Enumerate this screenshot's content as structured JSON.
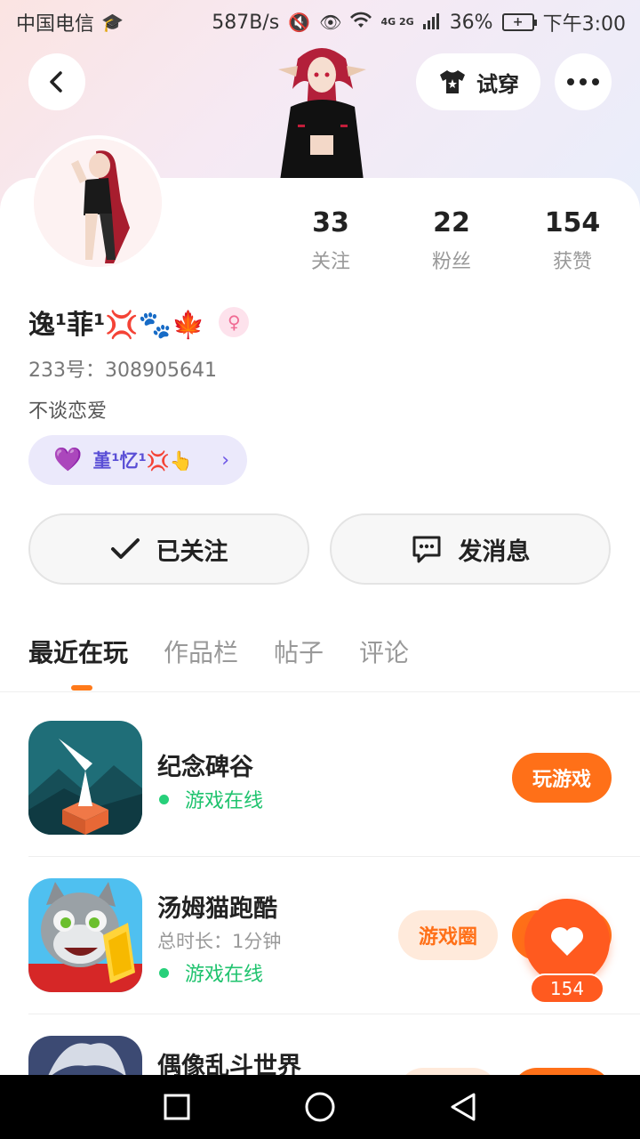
{
  "status_bar": {
    "carrier": "中国电信",
    "net_speed": "587B/s",
    "signal_label": "4G 2G",
    "battery_level": 36,
    "battery": "36%",
    "time": "下午3:00"
  },
  "header": {
    "tryon_label": "试穿"
  },
  "profile": {
    "stats": [
      {
        "value": "33",
        "label": "关注"
      },
      {
        "value": "22",
        "label": "粉丝"
      },
      {
        "value": "154",
        "label": "获赞"
      }
    ],
    "nickname": "逸¹菲¹💢🐾🍁",
    "gender_symbol": "♀",
    "uid": "233号：308905641",
    "signature": "不谈恋爱",
    "partner_name": "堇¹忆¹💢👆",
    "follow_label": "已关注",
    "message_label": "发消息"
  },
  "tabs": [
    {
      "label": "最近在玩",
      "active": true
    },
    {
      "label": "作品栏",
      "active": false
    },
    {
      "label": "帖子",
      "active": false
    },
    {
      "label": "评论",
      "active": false
    }
  ],
  "games": [
    {
      "title": "纪念碑谷",
      "meta": "",
      "status": "游戏在线",
      "primary_btn": "玩游戏",
      "secondary_btn": ""
    },
    {
      "title": "汤姆猫跑酷",
      "meta": "总时长：1分钟",
      "status": "游戏在线",
      "primary_btn": "",
      "secondary_btn": "游戏圈"
    },
    {
      "title": "偶像乱斗世界",
      "meta": "",
      "status": "",
      "primary_btn": "",
      "secondary_btn": ""
    }
  ],
  "like_float": {
    "count": "154"
  },
  "colors": {
    "accent": "#ff7018",
    "online": "#1fc36e",
    "partner": "#5a4fd6"
  }
}
